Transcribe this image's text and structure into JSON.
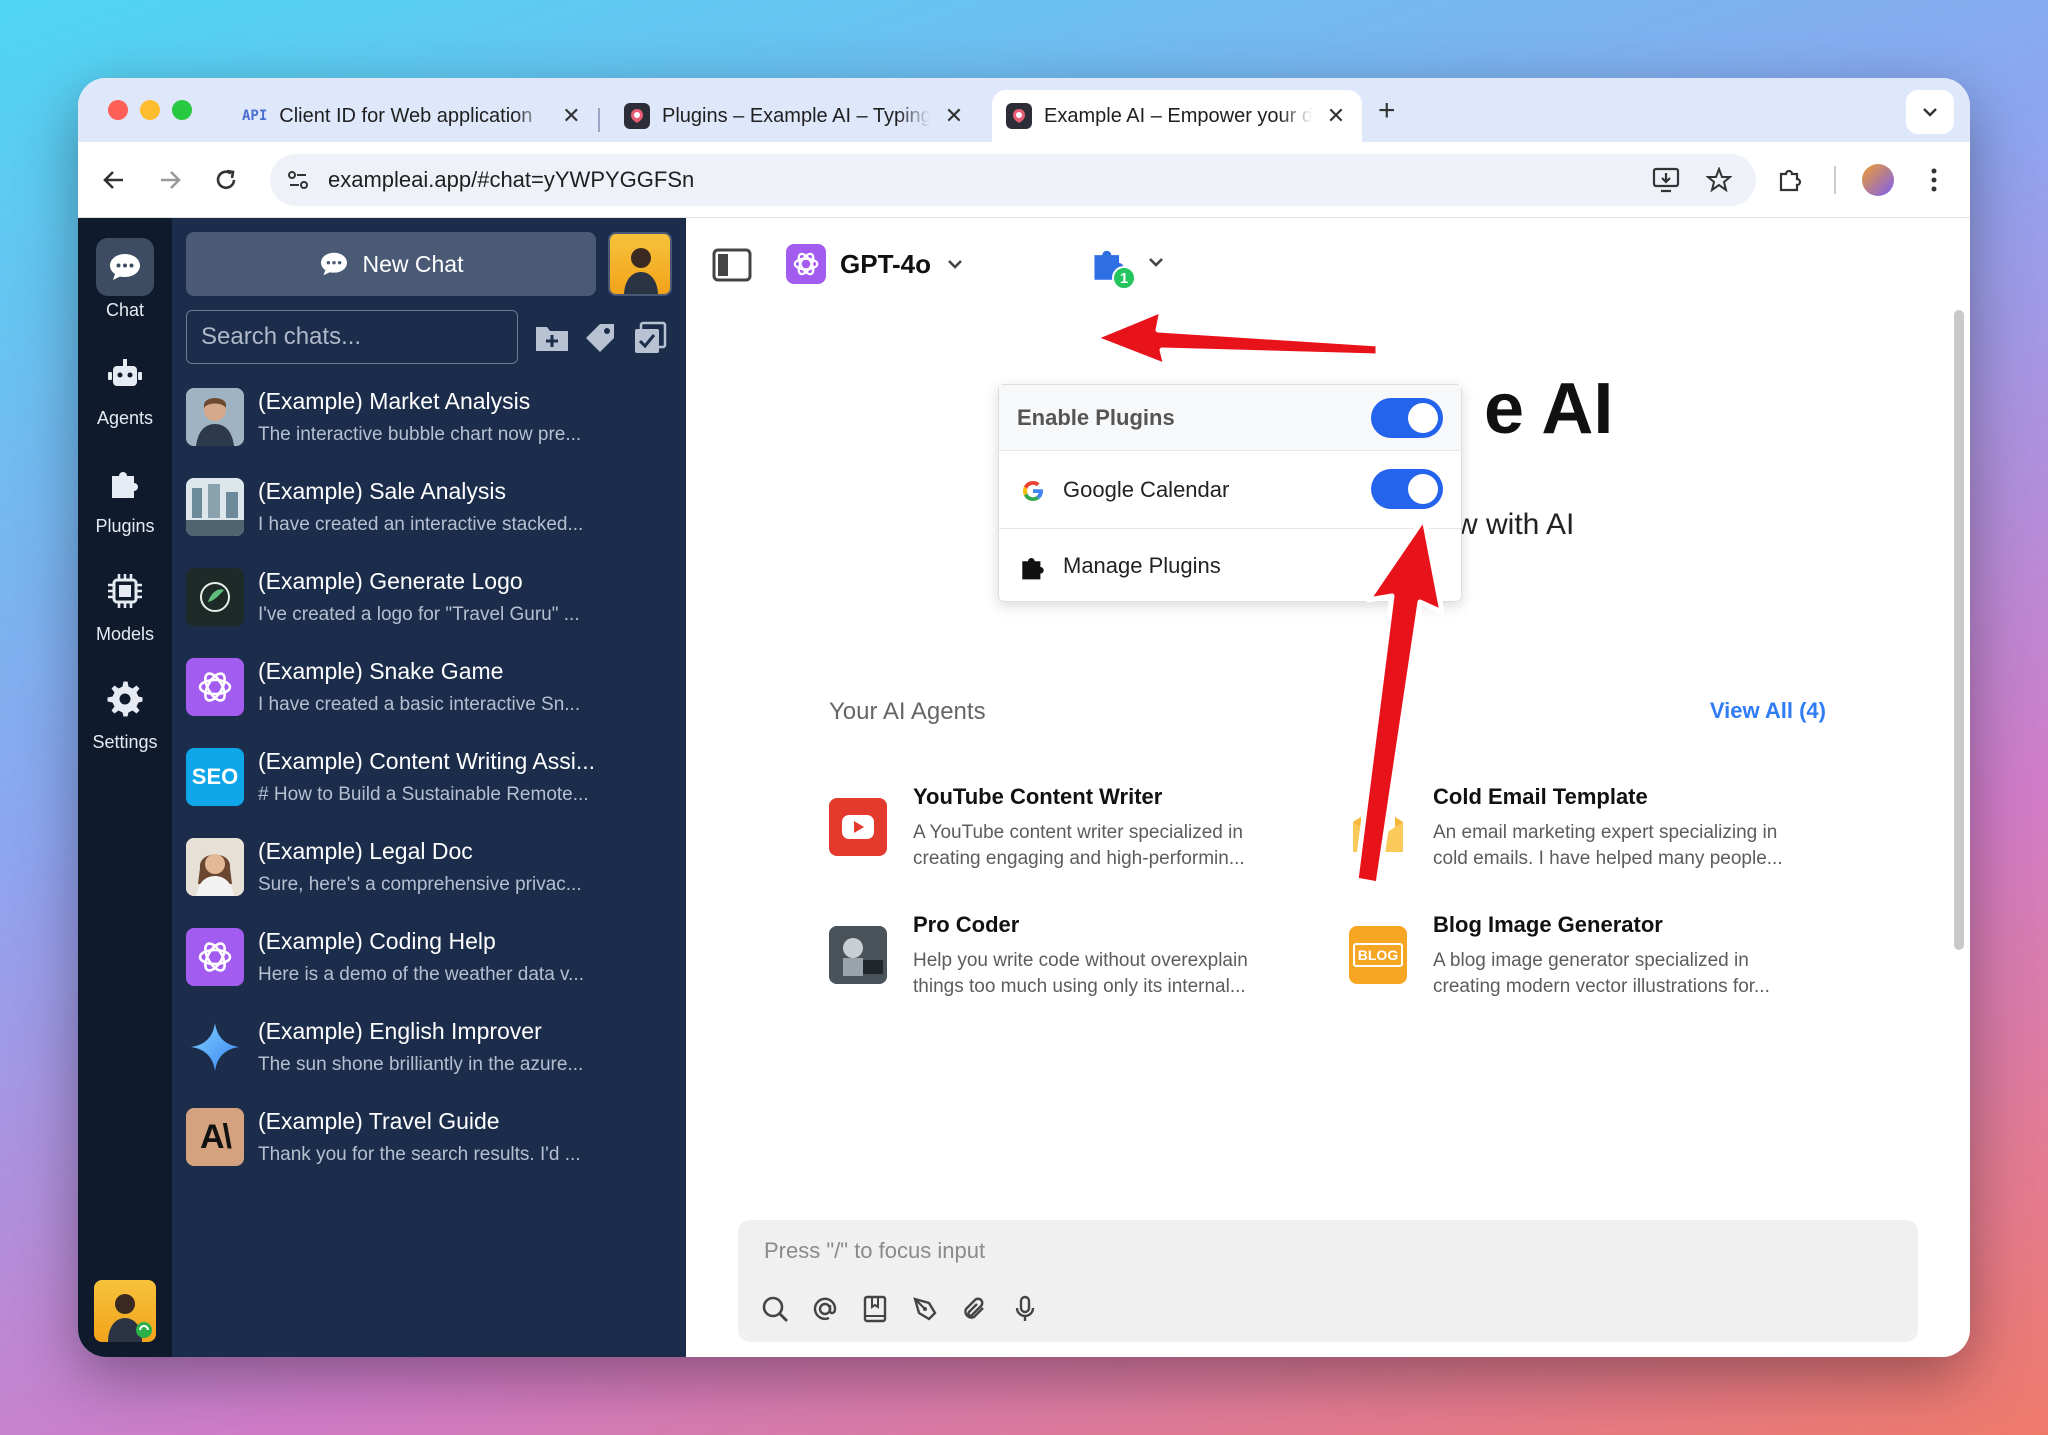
{
  "browser": {
    "tabs": [
      {
        "label": "Client ID for Web application",
        "favicon": "API",
        "active": false
      },
      {
        "label": "Plugins – Example AI – Typing",
        "favicon": "app-logo",
        "active": false
      },
      {
        "label": "Example AI – Empower your d",
        "favicon": "app-logo",
        "active": true
      }
    ],
    "url": "exampleai.app/#chat=yYWPYGGFSn"
  },
  "rail": {
    "items": [
      {
        "label": "Chat",
        "icon": "chat-bubble-icon",
        "active": true
      },
      {
        "label": "Agents",
        "icon": "robot-icon",
        "active": false
      },
      {
        "label": "Plugins",
        "icon": "puzzle-icon",
        "active": false
      },
      {
        "label": "Models",
        "icon": "chip-icon",
        "active": false
      },
      {
        "label": "Settings",
        "icon": "gear-icon",
        "active": false
      }
    ]
  },
  "sidebar": {
    "new_chat_label": "New Chat",
    "search_placeholder": "Search chats...",
    "chats": [
      {
        "title": "(Example) Market Analysis",
        "preview": "The interactive bubble chart now pre..."
      },
      {
        "title": "(Example) Sale Analysis",
        "preview": "I have created an interactive stacked..."
      },
      {
        "title": "(Example) Generate Logo",
        "preview": "I've created a logo for \"Travel Guru\" ..."
      },
      {
        "title": "(Example) Snake Game",
        "preview": "I have created a basic interactive Sn..."
      },
      {
        "title": "(Example) Content Writing Assi...",
        "preview": "# How to Build a Sustainable Remote..."
      },
      {
        "title": "(Example) Legal Doc",
        "preview": "Sure, here's a comprehensive privac..."
      },
      {
        "title": "(Example) Coding Help",
        "preview": "Here is a demo of the weather data v..."
      },
      {
        "title": "(Example) English Improver",
        "preview": "The sun shone brilliantly in the azure..."
      },
      {
        "title": "(Example) Travel Guide",
        "preview": "Thank you for the search results. I'd ..."
      }
    ],
    "seo_badge": "SEO",
    "anthropic_badge": "A\\"
  },
  "main": {
    "model_name": "GPT-4o",
    "plugin_count": "1",
    "hero_title_fragment": "e AI",
    "hero_sub_fragment": "w with AI",
    "agents_title": "Your AI Agents",
    "view_all": "View All (4)",
    "agents": [
      {
        "name": "YouTube Content Writer",
        "desc": "A YouTube content writer specialized in creating engaging and high-performin..."
      },
      {
        "name": "Cold Email Template",
        "desc": "An email marketing expert specializing in cold emails. I have helped many people..."
      },
      {
        "name": "Pro Coder",
        "desc": "Help you write code without overexplain things too much using only its internal..."
      },
      {
        "name": "Blog Image Generator",
        "desc": "A blog image generator specialized in creating modern vector illustrations for..."
      }
    ],
    "blog_badge": "BLOG",
    "input_placeholder": "Press \"/\" to focus input"
  },
  "plugins_dropdown": {
    "enable_label": "Enable Plugins",
    "enable_on": true,
    "items": [
      {
        "label": "Google Calendar",
        "on": true
      }
    ],
    "manage_label": "Manage Plugins"
  },
  "colors": {
    "accent": "#2463eb",
    "sidebar_bg": "#1c2d4c",
    "rail_bg": "#0f1a2c",
    "arrow": "#e8121a"
  }
}
